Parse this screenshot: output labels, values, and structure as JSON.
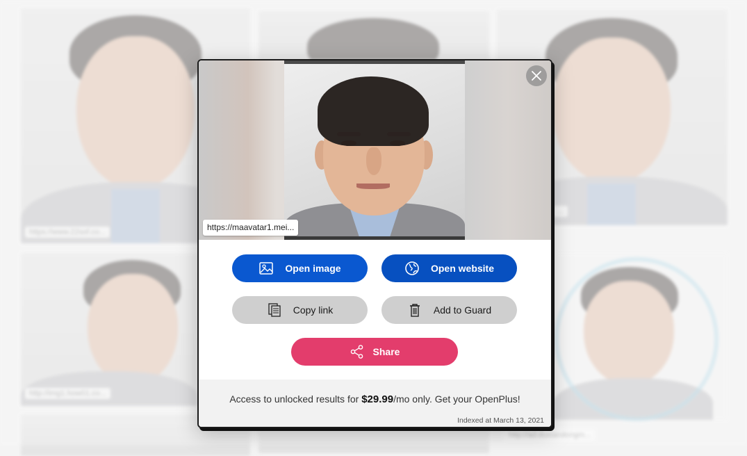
{
  "background": {
    "tile_urls": [
      "https://www.22sof.co...",
      "http://img1.how01.co...",
      "...",
      "...",
      "http://ad.duxiandongm..."
    ]
  },
  "modal": {
    "source_url": "https://maavatar1.mei...",
    "close_icon": "close-icon",
    "buttons": {
      "open_image": {
        "label": "Open image",
        "icon": "image-icon"
      },
      "open_website": {
        "label": "Open website",
        "icon": "globe-icon"
      },
      "copy_link": {
        "label": "Copy link",
        "icon": "copy-icon"
      },
      "add_to_guard": {
        "label": "Add to Guard",
        "icon": "trash-icon"
      },
      "share": {
        "label": "Share",
        "icon": "share-icon"
      }
    },
    "promo": {
      "prefix": "Access to unlocked results for ",
      "price": "$29.99",
      "suffix": "/mo only. Get your OpenPlus!"
    },
    "indexed": "Indexed at March 13, 2021"
  },
  "colors": {
    "primary_blue": "#0a58d0",
    "share_pink": "#e33d6c",
    "secondary_gray": "#cfcfcf"
  }
}
